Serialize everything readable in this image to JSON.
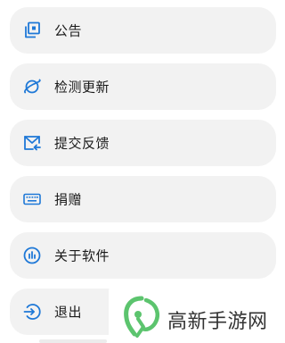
{
  "menu": {
    "items": [
      {
        "label": "公告",
        "icon": "notice-icon"
      },
      {
        "label": "检测更新",
        "icon": "planet-icon"
      },
      {
        "label": "提交反馈",
        "icon": "feedback-mail-icon"
      },
      {
        "label": "捐赠",
        "icon": "keyboard-icon"
      },
      {
        "label": "关于软件",
        "icon": "about-bars-icon"
      },
      {
        "label": "退出",
        "icon": "exit-icon"
      }
    ]
  },
  "colors": {
    "accent": "#1e78d7",
    "item_bg": "#f2f2f2",
    "text": "#1a1a1a",
    "logo_green": "#5cc46e"
  },
  "watermark": {
    "text": "高新手游网"
  }
}
